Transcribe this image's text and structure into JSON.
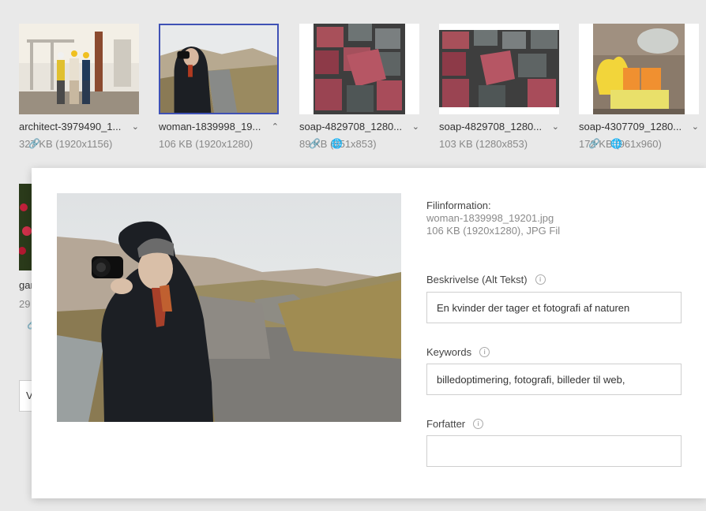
{
  "gallery": {
    "tiles": [
      {
        "name": "architect-3979490_1...",
        "meta": "327 KB (1920x1156)",
        "chevron": "chevron-down-icon",
        "icons": [
          "link-icon"
        ]
      },
      {
        "name": "woman-1839998_19...",
        "meta": "106 KB (1920x1280)",
        "chevron": "chevron-up-icon",
        "icons": []
      },
      {
        "name": "soap-4829708_1280...",
        "meta": "89 KB (851x853)",
        "chevron": "chevron-down-icon",
        "icons": [
          "link-icon",
          "globe-icon"
        ]
      },
      {
        "name": "soap-4829708_1280...",
        "meta": "103 KB (1280x853)",
        "chevron": "chevron-down-icon",
        "icons": []
      },
      {
        "name": "soap-4307709_1280...",
        "meta": "172 KB (961x960)",
        "chevron": "chevron-down-icon",
        "icons": [
          "link-icon",
          "globe-icon"
        ]
      }
    ],
    "peek": {
      "name": "gar",
      "meta": "29",
      "box": "V"
    }
  },
  "details": {
    "info_title": "Filinformation:",
    "file_name": "woman-1839998_19201.jpg",
    "file_meta": "106 KB (1920x1280), JPG Fil",
    "description_label": "Beskrivelse (Alt Tekst)",
    "description_value": "En kvinder der tager et fotografi af naturen",
    "keywords_label": "Keywords",
    "keywords_value": "billedoptimering, fotografi, billeder til web,",
    "author_label": "Forfatter",
    "author_value": ""
  },
  "colors": {
    "selected_border": "#3f51b5",
    "panel_bg": "#ffffff",
    "page_bg": "#e9e9e9"
  }
}
